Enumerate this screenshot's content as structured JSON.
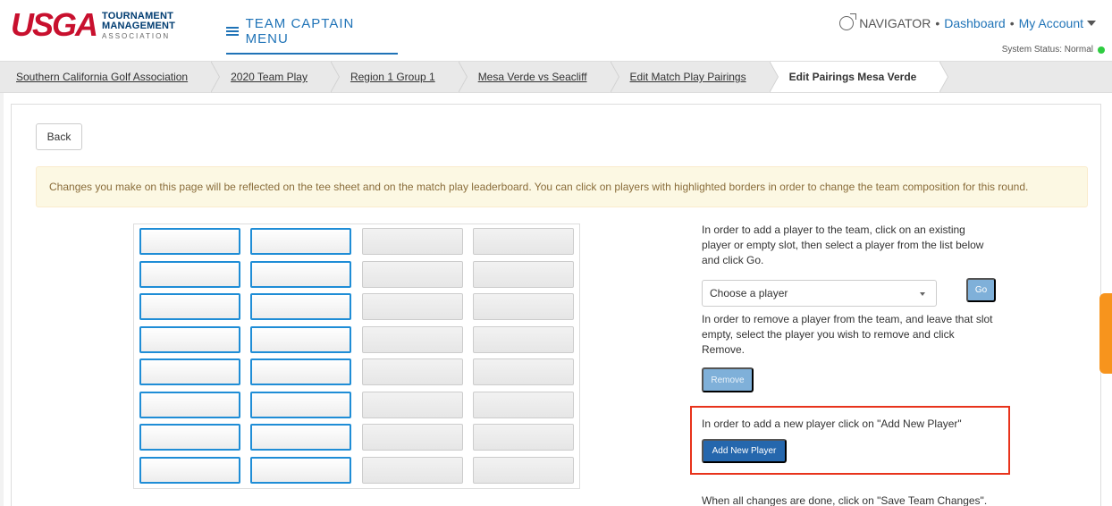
{
  "header": {
    "logo_main": "USGA",
    "logo_line1": "TOURNAMENT",
    "logo_line2": "MANAGEMENT",
    "logo_line3": "ASSOCIATION",
    "menu_label": "TEAM CAPTAIN MENU",
    "navigator_label": "NAVIGATOR",
    "dashboard_label": "Dashboard",
    "account_label": "My Account",
    "system_status": "System Status: Normal",
    "status_color": "#2ecc40"
  },
  "breadcrumb": [
    {
      "label": "Southern California Golf Association"
    },
    {
      "label": "2020 Team Play"
    },
    {
      "label": "Region 1 Group 1"
    },
    {
      "label": "Mesa Verde vs Seacliff"
    },
    {
      "label": "Edit Match Play Pairings"
    },
    {
      "label": "Edit Pairings Mesa Verde"
    }
  ],
  "main": {
    "back_label": "Back",
    "alert_text": "Changes you make on this page will be reflected on the tee sheet and on the match play leaderboard. You can click on players with highlighted borders in order to change the team composition for this round.",
    "grid_rows": 8,
    "instructions": {
      "add_existing": "In order to add a player to the team, click on an existing player or empty slot, then select a player from the list below and click Go.",
      "select_placeholder": "Choose a player",
      "go_label": "Go",
      "remove_text": "In order to remove a player from the team, and leave that slot empty, select the player you wish to remove and click Remove.",
      "remove_label": "Remove",
      "add_new_text": "In order to add a new player click on \"Add New Player\"",
      "add_new_label": "Add New Player",
      "save_text": "When all changes are done, click on \"Save Team Changes\"."
    }
  },
  "colors": {
    "brand_red": "#c8102e",
    "brand_blue": "#003c71",
    "link_blue": "#1f73b7",
    "highlight_border": "#1f8dd6",
    "primary_button": "#2567ad",
    "annotation_box": "#e8331b",
    "help_tab": "#f7941d"
  }
}
